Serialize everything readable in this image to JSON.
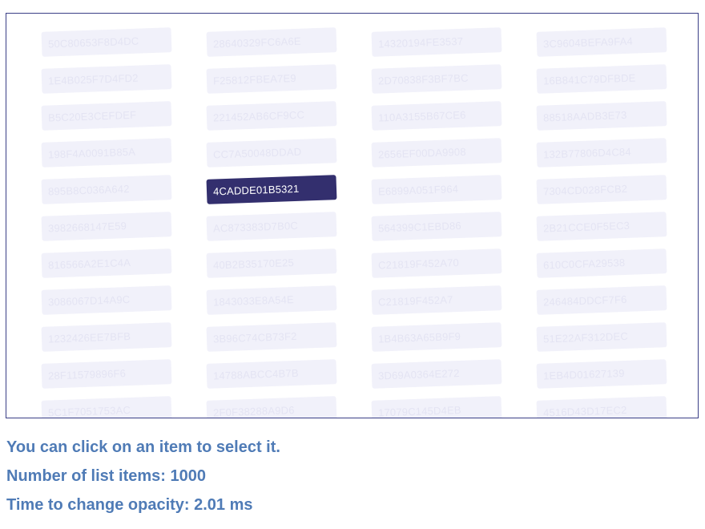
{
  "list": {
    "items": [
      "50C80653F8D4DC",
      "28640329FC6A6E",
      "14320194FE3537",
      "3C9604BEFA9FA4",
      "1E4B025F7D4FD2",
      "F25812FBEA7E9",
      "2D70838F3BF7BC",
      "16B841C79DFBDE",
      "B5C20E3CEFDEF",
      "221452AB6CF9CC",
      "110A3155B67CE6",
      "88518AADB3E73",
      "198F4A0091B85A",
      "CC7A50048DDAD",
      "2656EF00DA9908",
      "132B77806D4C84",
      "895B8C036A642",
      "4CADDE01B5321",
      "E6899A051F964",
      "7304CD028FCB2",
      "3982668147E59",
      "AC873383D7B0C",
      "564399C1EBD86",
      "2B21CCE0F5EC3",
      "816566A2E1C4A",
      "40B2B35170E25",
      "C21819F452A70",
      "610C0CFA29538",
      "3086067D14A9C",
      "1843033E8A54E",
      "C21819F452A7",
      "246484DDCF7F6",
      "1232426EE7BFB",
      "3B96C74CB73F2",
      "1B4B63A65B9F9",
      "51E22AF312DEC",
      "28F11579896F6",
      "14788ABCC4B7B",
      "3D69A0364E272",
      "1EB4D01627139",
      "5C1F7051753AC",
      "2F0F38288A9D6",
      "17079C145D4EB",
      "4516D43D17EC2"
    ],
    "selected_index": 17
  },
  "info": {
    "instruction": "You can click on an item to select it.",
    "count_text": "Number of list items: 1000",
    "timing_text": "Time to change opacity: 2.01 ms"
  }
}
